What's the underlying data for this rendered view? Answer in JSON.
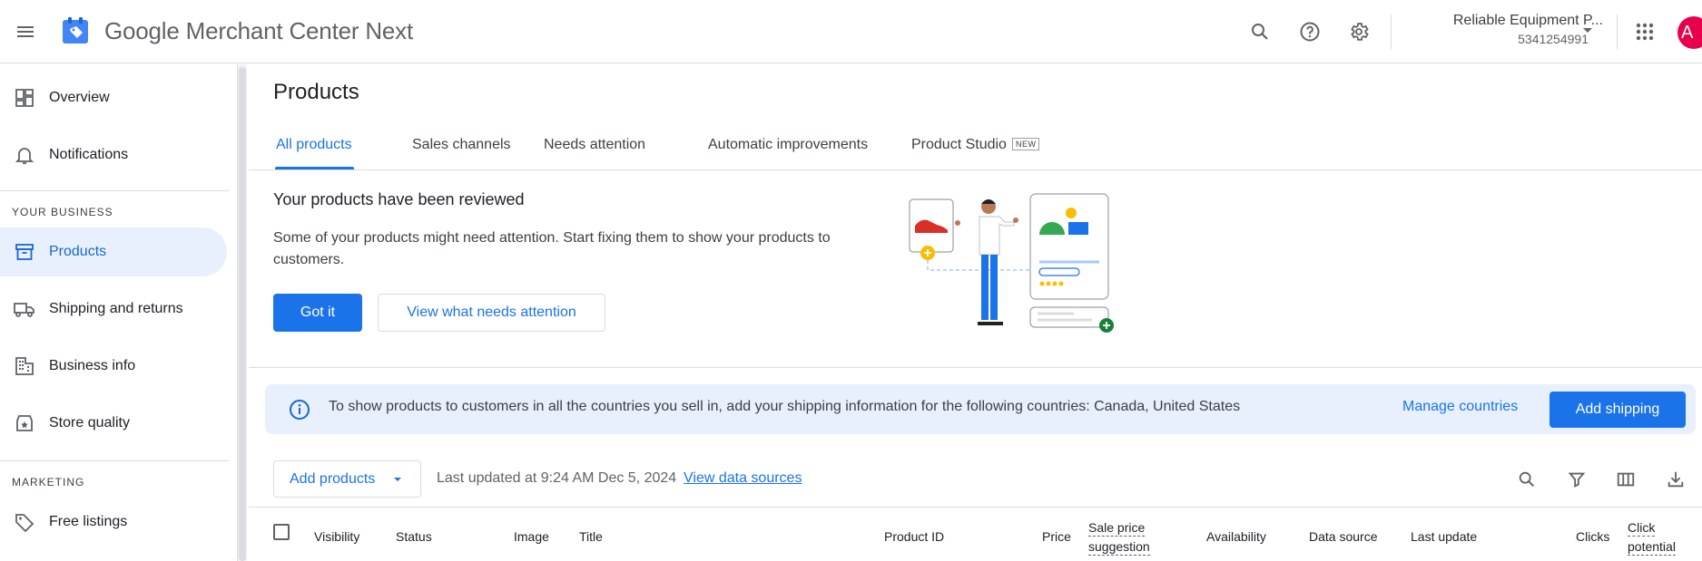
{
  "header": {
    "brand_google": "Google",
    "brand_rest": " Merchant Center Next",
    "account_name": "Reliable Equipment P...",
    "account_id": "5341254991",
    "avatar_letter": "A"
  },
  "sidebar": {
    "items": [
      {
        "label": "Overview"
      },
      {
        "label": "Notifications"
      },
      {
        "label": "Products"
      },
      {
        "label": "Shipping and returns"
      },
      {
        "label": "Business info"
      },
      {
        "label": "Store quality"
      },
      {
        "label": "Free listings"
      }
    ],
    "sections": {
      "business": "YOUR BUSINESS",
      "marketing": "MARKETING"
    }
  },
  "main": {
    "title": "Products",
    "tabs": [
      {
        "label": "All products"
      },
      {
        "label": "Sales channels"
      },
      {
        "label": "Needs attention"
      },
      {
        "label": "Automatic improvements"
      },
      {
        "label": "Product Studio",
        "badge": "NEW"
      }
    ],
    "review": {
      "title": "Your products have been reviewed",
      "description": "Some of your products might need attention. Start fixing them to show your products to customers.",
      "got_it": "Got it",
      "view_attention": "View what needs attention"
    },
    "banner": {
      "message": "To show products to customers in all the countries you sell in, add your shipping information for the following countries: Canada, United States",
      "manage_countries": "Manage countries",
      "add_shipping": "Add shipping"
    },
    "toolbar": {
      "add_products": "Add products",
      "last_updated": "Last updated at 9:24 AM Dec 5, 2024",
      "view_sources": "View data sources"
    },
    "table": {
      "headers": {
        "visibility": "Visibility",
        "status": "Status",
        "image": "Image",
        "title": "Title",
        "product_id": "Product ID",
        "price": "Price",
        "sale_price_1": "Sale price",
        "sale_price_2": "suggestion",
        "availability": "Availability",
        "data_source": "Data source",
        "last_update": "Last update",
        "clicks": "Clicks",
        "click_potential_1": "Click",
        "click_potential_2": "potential"
      }
    }
  },
  "colors": {
    "accent": "#1a73e8",
    "active_nav_bg": "#e8f0fe",
    "banner_bg": "#e8f0fe",
    "avatar": "#e8004c"
  },
  "icons": [
    "menu-icon",
    "merchant-logo-icon",
    "search-icon",
    "help-icon",
    "settings-icon",
    "caret-down-icon",
    "apps-grid-icon",
    "overview-icon",
    "bell-icon",
    "products-box-icon",
    "truck-icon",
    "building-icon",
    "store-quality-icon",
    "tag-icon",
    "info-icon",
    "filter-icon",
    "columns-icon",
    "download-icon"
  ]
}
